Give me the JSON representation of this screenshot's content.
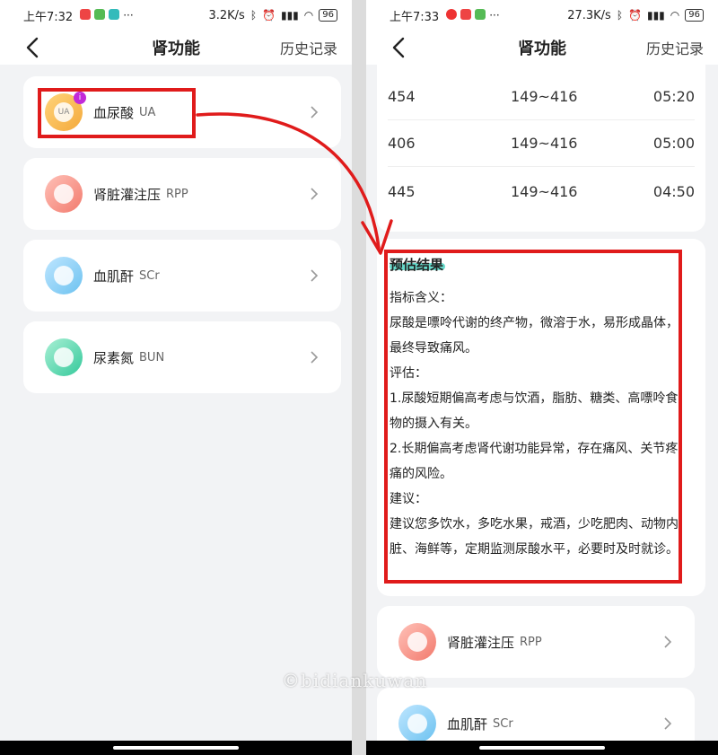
{
  "left": {
    "status": {
      "time": "上午7:32",
      "speed": "3.2K/s",
      "battery": "96"
    },
    "nav": {
      "title": "肾功能",
      "action": "历史记录"
    },
    "items": [
      {
        "name": "血尿酸",
        "abbr": "UA",
        "badge": "i",
        "icon_inner": "UA",
        "color": "orange"
      },
      {
        "name": "肾脏灌注压",
        "abbr": "RPP",
        "color": "pink"
      },
      {
        "name": "血肌酐",
        "abbr": "SCr",
        "color": "blue"
      },
      {
        "name": "尿素氮",
        "abbr": "BUN",
        "color": "green"
      }
    ]
  },
  "right": {
    "status": {
      "time": "上午7:33",
      "speed": "27.3K/s",
      "battery": "96"
    },
    "nav": {
      "title": "肾功能",
      "action": "历史记录"
    },
    "table_rows": [
      {
        "value": "454",
        "range": "149~416",
        "time": "05:20"
      },
      {
        "value": "406",
        "range": "149~416",
        "time": "05:00"
      },
      {
        "value": "445",
        "range": "149~416",
        "time": "04:50"
      }
    ],
    "estimate": {
      "title": "预估结果",
      "lines": [
        "指标含义：",
        "尿酸是嘌呤代谢的终产物，微溶于水，易形成晶体，最终导致痛风。",
        "评估：",
        "1.尿酸短期偏高考虑与饮酒，脂肪、糖类、高嘌呤食物的摄入有关。",
        "2.长期偏高考虑肾代谢功能异常，存在痛风、关节疼痛的风险。",
        "建议：",
        "建议您多饮水，多吃水果，戒酒，少吃肥肉、动物内脏、海鲜等，定期监测尿酸水平，必要时及时就诊。"
      ]
    },
    "items": [
      {
        "name": "肾脏灌注压",
        "abbr": "RPP"
      },
      {
        "name": "血肌酐",
        "abbr": "SCr"
      }
    ]
  },
  "watermark": "©bidiankuwan",
  "colors": {
    "highlight_box": "#e01b1b",
    "arrow": "#e01b1b",
    "title_underline": "#4fd6c4"
  }
}
